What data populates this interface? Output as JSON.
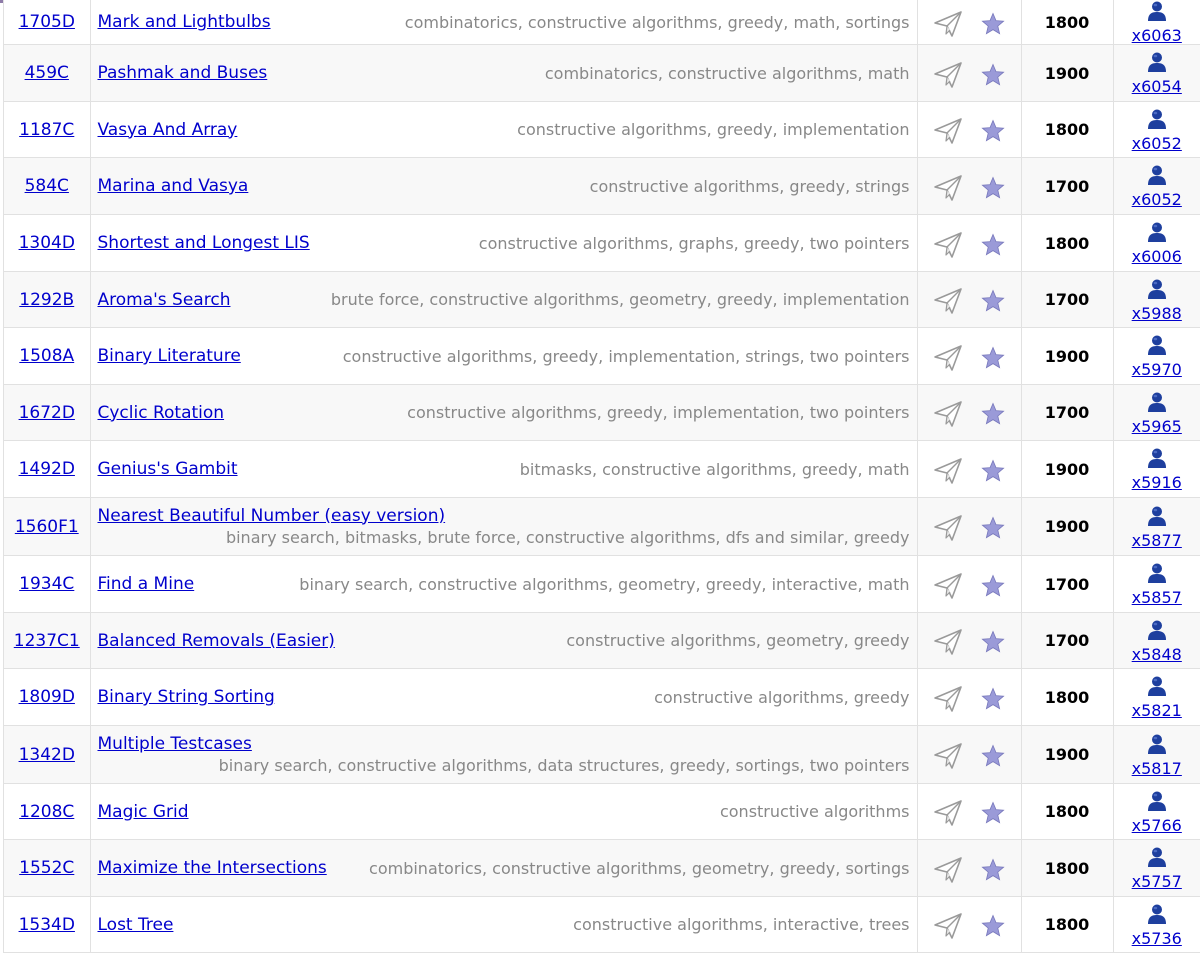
{
  "colors": {
    "link": "#0000cc",
    "tag": "#888888",
    "row_alt": "#f8f8f8",
    "top_bar": "#8e7ba8",
    "user_icon": "#1e3f9e",
    "star": "#9a9ad8"
  },
  "icons": {
    "submit": "paper-plane-icon",
    "favourite": "star-icon",
    "solved_by": "user-icon"
  },
  "problems": [
    {
      "id": "1705D",
      "name": "Mark and Lightbulbs",
      "tags": [
        "combinatorics",
        "constructive algorithms",
        "greedy",
        "math",
        "sortings"
      ],
      "rating": "1800",
      "solved": "x6063",
      "layout": "oneline"
    },
    {
      "id": "459C",
      "name": "Pashmak and Buses",
      "tags": [
        "combinatorics",
        "constructive algorithms",
        "math"
      ],
      "rating": "1900",
      "solved": "x6054",
      "layout": "oneline"
    },
    {
      "id": "1187C",
      "name": "Vasya And Array",
      "tags": [
        "constructive algorithms",
        "greedy",
        "implementation"
      ],
      "rating": "1800",
      "solved": "x6052",
      "layout": "oneline"
    },
    {
      "id": "584C",
      "name": "Marina and Vasya",
      "tags": [
        "constructive algorithms",
        "greedy",
        "strings"
      ],
      "rating": "1700",
      "solved": "x6052",
      "layout": "oneline"
    },
    {
      "id": "1304D",
      "name": "Shortest and Longest LIS",
      "tags": [
        "constructive algorithms",
        "graphs",
        "greedy",
        "two pointers"
      ],
      "rating": "1800",
      "solved": "x6006",
      "layout": "oneline"
    },
    {
      "id": "1292B",
      "name": "Aroma's Search",
      "tags": [
        "brute force",
        "constructive algorithms",
        "geometry",
        "greedy",
        "implementation"
      ],
      "rating": "1700",
      "solved": "x5988",
      "layout": "oneline"
    },
    {
      "id": "1508A",
      "name": "Binary Literature",
      "tags": [
        "constructive algorithms",
        "greedy",
        "implementation",
        "strings",
        "two pointers"
      ],
      "rating": "1900",
      "solved": "x5970",
      "layout": "oneline"
    },
    {
      "id": "1672D",
      "name": "Cyclic Rotation",
      "tags": [
        "constructive algorithms",
        "greedy",
        "implementation",
        "two pointers"
      ],
      "rating": "1700",
      "solved": "x5965",
      "layout": "oneline"
    },
    {
      "id": "1492D",
      "name": "Genius's Gambit",
      "tags": [
        "bitmasks",
        "constructive algorithms",
        "greedy",
        "math"
      ],
      "rating": "1900",
      "solved": "x5916",
      "layout": "oneline"
    },
    {
      "id": "1560F1",
      "name": "Nearest Beautiful Number (easy version)",
      "tags": [
        "binary search",
        "bitmasks",
        "brute force",
        "constructive algorithms",
        "dfs and similar",
        "greedy"
      ],
      "rating": "1900",
      "solved": "x5877",
      "layout": "twoline"
    },
    {
      "id": "1934C",
      "name": "Find a Mine",
      "tags": [
        "binary search",
        "constructive algorithms",
        "geometry",
        "greedy",
        "interactive",
        "math"
      ],
      "rating": "1700",
      "solved": "x5857",
      "layout": "oneline"
    },
    {
      "id": "1237C1",
      "name": "Balanced Removals (Easier)",
      "tags": [
        "constructive algorithms",
        "geometry",
        "greedy"
      ],
      "rating": "1700",
      "solved": "x5848",
      "layout": "oneline"
    },
    {
      "id": "1809D",
      "name": "Binary String Sorting",
      "tags": [
        "constructive algorithms",
        "greedy"
      ],
      "rating": "1800",
      "solved": "x5821",
      "layout": "oneline"
    },
    {
      "id": "1342D",
      "name": "Multiple Testcases",
      "tags": [
        "binary search",
        "constructive algorithms",
        "data structures",
        "greedy",
        "sortings",
        "two pointers"
      ],
      "rating": "1900",
      "solved": "x5817",
      "layout": "twoline"
    },
    {
      "id": "1208C",
      "name": "Magic Grid",
      "tags": [
        "constructive algorithms"
      ],
      "rating": "1800",
      "solved": "x5766",
      "layout": "oneline"
    },
    {
      "id": "1552C",
      "name": "Maximize the Intersections",
      "tags": [
        "combinatorics",
        "constructive algorithms",
        "geometry",
        "greedy",
        "sortings"
      ],
      "rating": "1800",
      "solved": "x5757",
      "layout": "oneline"
    },
    {
      "id": "1534D",
      "name": "Lost Tree",
      "tags": [
        "constructive algorithms",
        "interactive",
        "trees"
      ],
      "rating": "1800",
      "solved": "x5736",
      "layout": "oneline"
    }
  ]
}
